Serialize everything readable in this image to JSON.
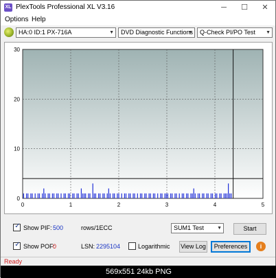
{
  "window": {
    "title": "PlexTools Professional XL V3.16",
    "icon_label": "XL",
    "minimize_glyph": "─",
    "maximize_glyph": "☐",
    "close_glyph": "✕"
  },
  "menu": {
    "options": "Options",
    "help": "Help"
  },
  "toolbar": {
    "drive": "HA:0 ID:1  PX-716A",
    "function": "DVD Diagnostic Functions",
    "test": "Q-Check PI/PO Test"
  },
  "chart_data": {
    "type": "bar",
    "title": "",
    "xlabel": "",
    "ylabel": "",
    "xlim": [
      0,
      5
    ],
    "ylim": [
      0,
      30
    ],
    "x_ticks": [
      "0",
      "1",
      "2",
      "3",
      "4",
      "5"
    ],
    "y_ticks": [
      "0",
      "10",
      "20",
      "30"
    ],
    "threshold_line": 4,
    "scan_end_x": 4.38,
    "grid": true,
    "background_gradient": [
      "#9fb3b3",
      "#ffffff"
    ],
    "series": [
      {
        "color": "#1f2fd8",
        "x": [
          0.02,
          0.05,
          0.08,
          0.11,
          0.14,
          0.17,
          0.2,
          0.23,
          0.26,
          0.29,
          0.32,
          0.35,
          0.38,
          0.41,
          0.44,
          0.47,
          0.5,
          0.53,
          0.56,
          0.59,
          0.62,
          0.65,
          0.68,
          0.71,
          0.74,
          0.77,
          0.8,
          0.83,
          0.86,
          0.89,
          0.92,
          0.95,
          0.98,
          1.01,
          1.04,
          1.07,
          1.1,
          1.13,
          1.16,
          1.19,
          1.22,
          1.25,
          1.28,
          1.31,
          1.34,
          1.37,
          1.4,
          1.43,
          1.46,
          1.49,
          1.52,
          1.55,
          1.58,
          1.61,
          1.64,
          1.67,
          1.7,
          1.73,
          1.76,
          1.79,
          1.82,
          1.85,
          1.88,
          1.91,
          1.94,
          1.97,
          2.0,
          2.03,
          2.06,
          2.09,
          2.12,
          2.15,
          2.18,
          2.21,
          2.24,
          2.27,
          2.3,
          2.33,
          2.36,
          2.39,
          2.42,
          2.45,
          2.48,
          2.51,
          2.54,
          2.57,
          2.6,
          2.63,
          2.66,
          2.69,
          2.72,
          2.75,
          2.78,
          2.81,
          2.84,
          2.87,
          2.9,
          2.93,
          2.96,
          2.99,
          3.02,
          3.05,
          3.08,
          3.11,
          3.14,
          3.17,
          3.2,
          3.23,
          3.26,
          3.29,
          3.32,
          3.35,
          3.38,
          3.41,
          3.44,
          3.47,
          3.5,
          3.53,
          3.56,
          3.59,
          3.62,
          3.65,
          3.68,
          3.71,
          3.74,
          3.77,
          3.8,
          3.83,
          3.86,
          3.89,
          3.92,
          3.95,
          3.98,
          4.01,
          4.04,
          4.07,
          4.1,
          4.13,
          4.16,
          4.19,
          4.22,
          4.25,
          4.28,
          4.31,
          4.34
        ],
        "values": [
          1,
          0,
          1,
          1,
          0,
          1,
          1,
          0,
          1,
          0,
          1,
          1,
          0,
          1,
          2,
          1,
          0,
          1,
          1,
          0,
          1,
          1,
          0,
          1,
          1,
          0,
          1,
          0,
          1,
          1,
          0,
          1,
          1,
          0,
          1,
          1,
          0,
          1,
          1,
          0,
          2,
          1,
          1,
          1,
          0,
          1,
          1,
          0,
          3,
          1,
          1,
          0,
          1,
          1,
          0,
          1,
          1,
          0,
          1,
          2,
          1,
          0,
          1,
          1,
          0,
          1,
          1,
          0,
          1,
          0,
          1,
          1,
          0,
          1,
          1,
          0,
          1,
          1,
          0,
          1,
          0,
          1,
          1,
          0,
          1,
          1,
          0,
          1,
          1,
          0,
          1,
          1,
          0,
          1,
          0,
          1,
          1,
          0,
          1,
          1,
          1,
          0,
          1,
          1,
          0,
          1,
          1,
          0,
          1,
          0,
          1,
          1,
          0,
          1,
          1,
          0,
          1,
          1,
          2,
          1,
          0,
          1,
          1,
          0,
          1,
          1,
          0,
          1,
          1,
          0,
          1,
          1,
          0,
          1,
          1,
          0,
          1,
          1,
          0,
          1,
          1,
          1,
          3,
          1,
          1
        ]
      }
    ]
  },
  "controls": {
    "show_pif_label": "Show PIF:",
    "pif_value": "500",
    "pif_unit": "rows/1ECC",
    "show_pof_label": "Show POF:",
    "pof_value": "0",
    "lsn_label": "LSN:",
    "lsn_value": "2295104",
    "logarithmic_label": "Logarithmic",
    "sum_select": "SUM1 Test",
    "start_button": "Start",
    "view_log_button": "View Log",
    "preferences_button": "Preferences",
    "info_glyph": "i",
    "check_glyph": "✓"
  },
  "status": {
    "text": "Ready"
  },
  "caption": {
    "text": "569x551  24kb  PNG"
  }
}
